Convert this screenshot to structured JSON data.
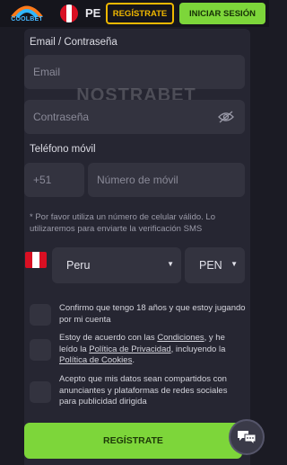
{
  "header": {
    "logo_text": "COOLBET",
    "country_code": "PE",
    "register_label": "REGÍSTRATE",
    "login_label": "INICIAR SESIÓN"
  },
  "form": {
    "credentials_label": "Email / Contraseña",
    "email_placeholder": "Email",
    "password_placeholder": "Contraseña",
    "watermark": "NOSTRABET",
    "phone_label": "Teléfono móvil",
    "phone_prefix": "+51",
    "phone_placeholder": "Número de móvil",
    "note": "* Por favor utiliza un número de celular válido. Lo utilizaremos para enviarte la verificación SMS",
    "country_value": "Peru",
    "currency_value": "PEN",
    "consents": {
      "age": "Confirmo que tengo 18 años y que estoy jugando por mi cuenta",
      "terms_prefix": "Estoy de acuerdo con las ",
      "terms_link": "Condiciones",
      "terms_mid": ", y he leído la ",
      "privacy_link": "Política de Privacidad",
      "cookies_mid": ", incluyendo la ",
      "cookies_link": "Política de Cookies",
      "cookies_end": ".",
      "marketing": "Acepto que mis datos sean compartidos con anunciantes y plataformas de redes sociales para publicidad dirigida"
    },
    "submit_label": "REGÍSTRATE"
  },
  "colors": {
    "accent_green": "#7dd63a",
    "accent_yellow": "#f0b800",
    "peru_red": "#d91023",
    "background": "#1b1b24"
  },
  "icons": {
    "password_toggle": "eye-slash-icon",
    "chat": "chat-bubble-icon",
    "caret": "caret-down-icon"
  }
}
